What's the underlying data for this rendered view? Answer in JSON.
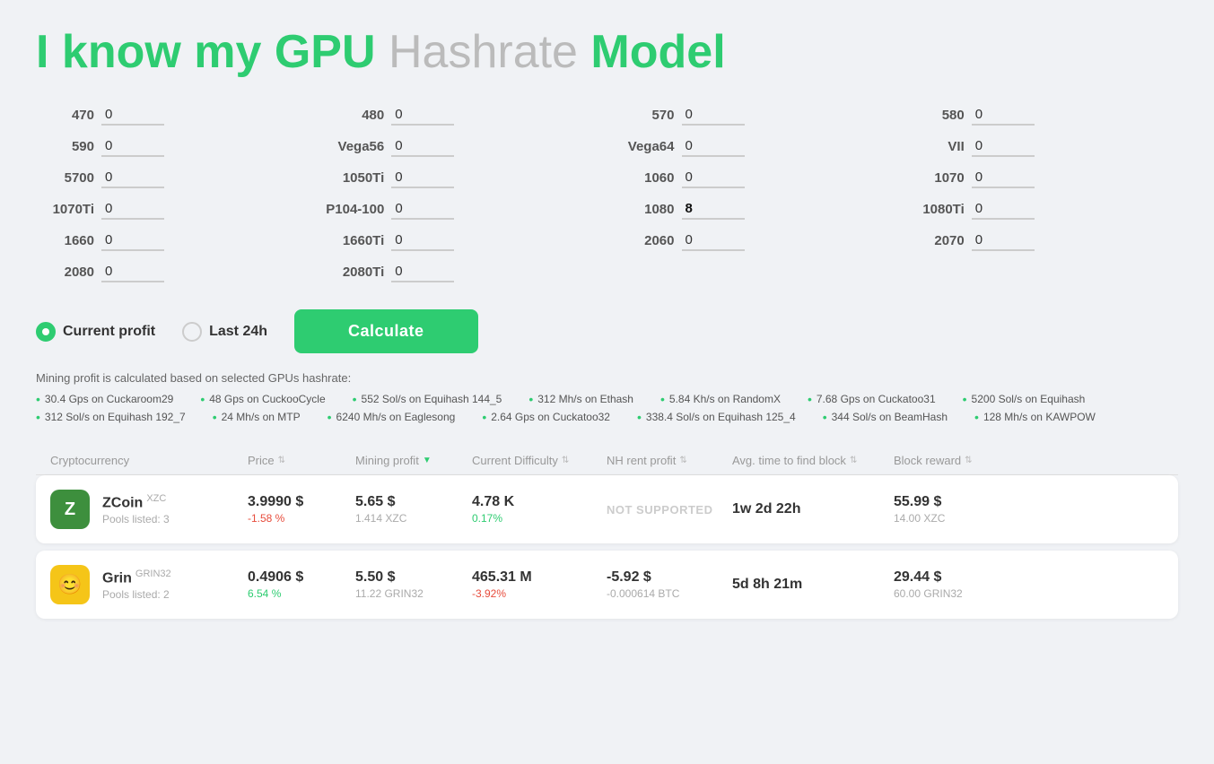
{
  "page": {
    "title": "I know my GPU ",
    "title_highlight": "Hashrate",
    "title_suffix": " Model"
  },
  "gpu_inputs": [
    {
      "label": "470",
      "value": "0",
      "highlight": false
    },
    {
      "label": "480",
      "value": "0",
      "highlight": false
    },
    {
      "label": "570",
      "value": "0",
      "highlight": false
    },
    {
      "label": "580",
      "value": "0",
      "highlight": false
    },
    {
      "label": "590",
      "value": "0",
      "highlight": false
    },
    {
      "label": "Vega56",
      "value": "0",
      "highlight": false
    },
    {
      "label": "Vega64",
      "value": "0",
      "highlight": false
    },
    {
      "label": "VII",
      "value": "0",
      "highlight": false
    },
    {
      "label": "5700",
      "value": "0",
      "highlight": false
    },
    {
      "label": "1050Ti",
      "value": "0",
      "highlight": false
    },
    {
      "label": "1060",
      "value": "0",
      "highlight": false
    },
    {
      "label": "1070",
      "value": "0",
      "highlight": false
    },
    {
      "label": "1070Ti",
      "value": "0",
      "highlight": false
    },
    {
      "label": "P104-100",
      "value": "0",
      "highlight": false
    },
    {
      "label": "1080",
      "value": "8",
      "highlight": true
    },
    {
      "label": "1080Ti",
      "value": "0",
      "highlight": false
    },
    {
      "label": "1660",
      "value": "0",
      "highlight": false
    },
    {
      "label": "1660Ti",
      "value": "0",
      "highlight": false
    },
    {
      "label": "2060",
      "value": "0",
      "highlight": false
    },
    {
      "label": "2070",
      "value": "0",
      "highlight": false
    },
    {
      "label": "2080",
      "value": "0",
      "highlight": false
    },
    {
      "label": "2080Ti",
      "value": "0",
      "highlight": false
    }
  ],
  "controls": {
    "option1_label": "Current profit",
    "option2_label": "Last 24h",
    "calculate_label": "Calculate"
  },
  "hashrate_note": "Mining profit is calculated based on selected GPUs hashrate:",
  "hashrate_items": [
    "30.4 Gps on Cuckaroom29",
    "48 Gps on CuckooCycle",
    "552 Sol/s on Equihash 144_5",
    "312 Mh/s on Ethash",
    "5.84 Kh/s on RandomX",
    "7.68 Gps on Cuckatoo31",
    "5200 Sol/s on Equihash",
    "312 Sol/s on Equihash 192_7",
    "24 Mh/s on MTP",
    "6240 Mh/s on Eaglesong",
    "2.64 Gps on Cuckatoo32",
    "338.4 Sol/s on Equihash 125_4",
    "344 Sol/s on BeamHash",
    "128 Mh/s on KAWPOW"
  ],
  "table_headers": [
    {
      "label": "Cryptocurrency",
      "sortable": false
    },
    {
      "label": "Price",
      "sortable": true
    },
    {
      "label": "Mining profit",
      "sortable": true,
      "active": true
    },
    {
      "label": "Current Difficulty",
      "sortable": true
    },
    {
      "label": "NH rent profit",
      "sortable": true
    },
    {
      "label": "Avg. time to find block",
      "sortable": true
    },
    {
      "label": "Block reward",
      "sortable": true
    }
  ],
  "table_rows": [
    {
      "coin_id": "zcoin",
      "coin_icon_text": "Z",
      "coin_icon_class": "zcoin",
      "coin_name": "ZCoin",
      "coin_ticker": "XZC",
      "coin_pools": "Pools listed: 3",
      "price_main": "3.9990 $",
      "price_sub": "-1.58 %",
      "price_sub_class": "negative",
      "profit_main": "5.65 $",
      "profit_sub": "1.414 XZC",
      "profit_sub_class": "",
      "difficulty_main": "4.78 K",
      "difficulty_sub": "0.17%",
      "difficulty_sub_class": "positive",
      "nh_rent": "NOT SUPPORTED",
      "nh_rent_not_supported": true,
      "avg_time": "1w 2d 22h",
      "block_reward_main": "55.99 $",
      "block_reward_sub": "14.00 XZC"
    },
    {
      "coin_id": "grin",
      "coin_icon_text": "😊",
      "coin_icon_class": "grin",
      "coin_name": "Grin",
      "coin_ticker": "GRIN32",
      "coin_pools": "Pools listed: 2",
      "price_main": "0.4906 $",
      "price_sub": "6.54 %",
      "price_sub_class": "positive",
      "profit_main": "5.50 $",
      "profit_sub": "11.22 GRIN32",
      "profit_sub_class": "",
      "difficulty_main": "465.31 M",
      "difficulty_sub": "-3.92%",
      "difficulty_sub_class": "negative",
      "nh_rent": "-5.92 $",
      "nh_rent_sub": "-0.000614 BTC",
      "nh_rent_not_supported": false,
      "avg_time": "5d 8h 21m",
      "block_reward_main": "29.44 $",
      "block_reward_sub": "60.00 GRIN32"
    }
  ]
}
